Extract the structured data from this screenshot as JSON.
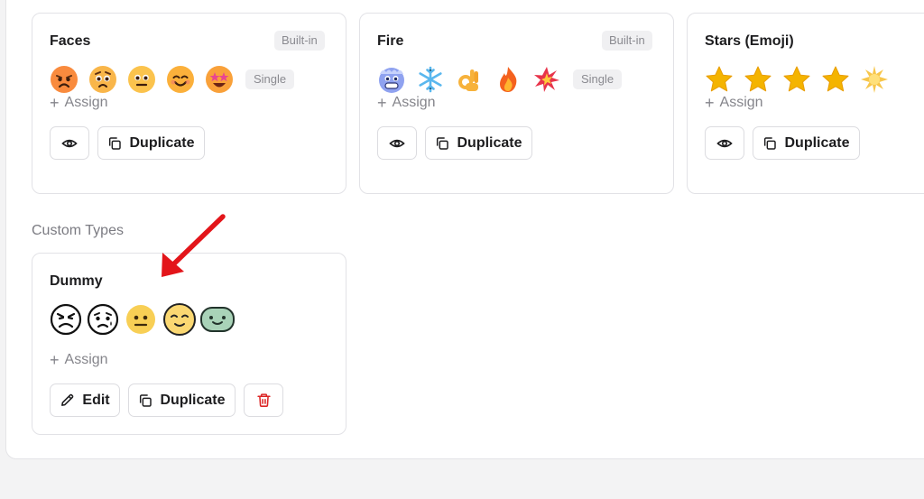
{
  "builtin_cards": [
    {
      "title": "Faces",
      "badge": "Built-in",
      "mode": "Single",
      "emojis": [
        "angry-face-icon",
        "worried-face-icon",
        "neutral-face-icon",
        "smiling-face-icon",
        "star-struck-face-icon"
      ]
    },
    {
      "title": "Fire",
      "badge": "Built-in",
      "mode": "Single",
      "emojis": [
        "cold-face-icon",
        "snowflake-icon",
        "ok-hand-icon",
        "fire-icon",
        "collision-icon"
      ]
    },
    {
      "title": "Stars (Emoji)",
      "emojis": [
        "star-icon",
        "star-icon",
        "star-icon",
        "star-icon",
        "glowing-star-icon"
      ]
    }
  ],
  "assign_label": "Assign",
  "duplicate_label": "Duplicate",
  "edit_label": "Edit",
  "section_label": "Custom Types",
  "custom_card": {
    "title": "Dummy",
    "emojis": [
      "angry-outline-icon",
      "sad-outline-icon",
      "neutral-yellow-icon",
      "content-face-icon",
      "green-blob-icon"
    ]
  },
  "colors": {
    "delete": "#dc2626",
    "arrow": "#e3151a",
    "star": "#f4b400"
  }
}
